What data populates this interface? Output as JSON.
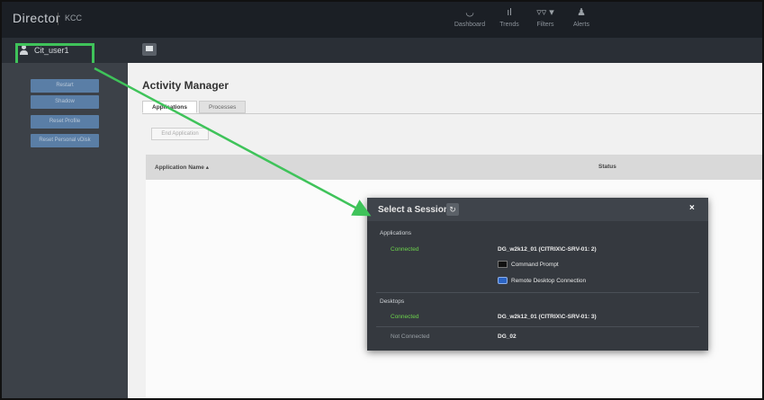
{
  "header": {
    "brand": "Director",
    "site": "KCC",
    "nav": [
      {
        "label": "Dashboard",
        "icon": "dashboard-icon",
        "glyph": "◡"
      },
      {
        "label": "Trends",
        "icon": "trends-icon",
        "glyph": "ıl"
      },
      {
        "label": "Filters",
        "icon": "filters-icon",
        "glyph": "▿▿ ▾"
      },
      {
        "label": "Alerts",
        "icon": "alerts-icon",
        "glyph": "♟"
      }
    ]
  },
  "subbar": {
    "user": "Cit_user1"
  },
  "sidebar": {
    "buttons": [
      "Restart",
      "Shadow",
      "Reset Profile",
      "Reset Personal vDisk"
    ]
  },
  "main": {
    "title": "Activity Manager",
    "tabs": [
      "Applications",
      "Processes"
    ],
    "end_button": "End Application",
    "columns": [
      "Application Name ▴",
      "Status"
    ]
  },
  "modal": {
    "title": "Select a Session",
    "refresh_glyph": "↻",
    "close_glyph": "×",
    "applications_label": "Applications",
    "app_session": {
      "status": "Connected",
      "name": "DG_w2k12_01 (CITRIX\\C-SRV-01: 2)"
    },
    "apps": [
      "Command Prompt",
      "Remote Desktop Connection"
    ],
    "desktops_label": "Desktops",
    "desktop_sessions": [
      {
        "status": "Connected",
        "name": "DG_w2k12_01 (CITRIX\\C-SRV-01: 3)"
      },
      {
        "status": "Not Connected",
        "name": "DG_02"
      }
    ]
  },
  "colors": {
    "highlight": "#3fc35a",
    "connected": "#6cd34c",
    "sidebar_button": "#5a7ea6"
  }
}
